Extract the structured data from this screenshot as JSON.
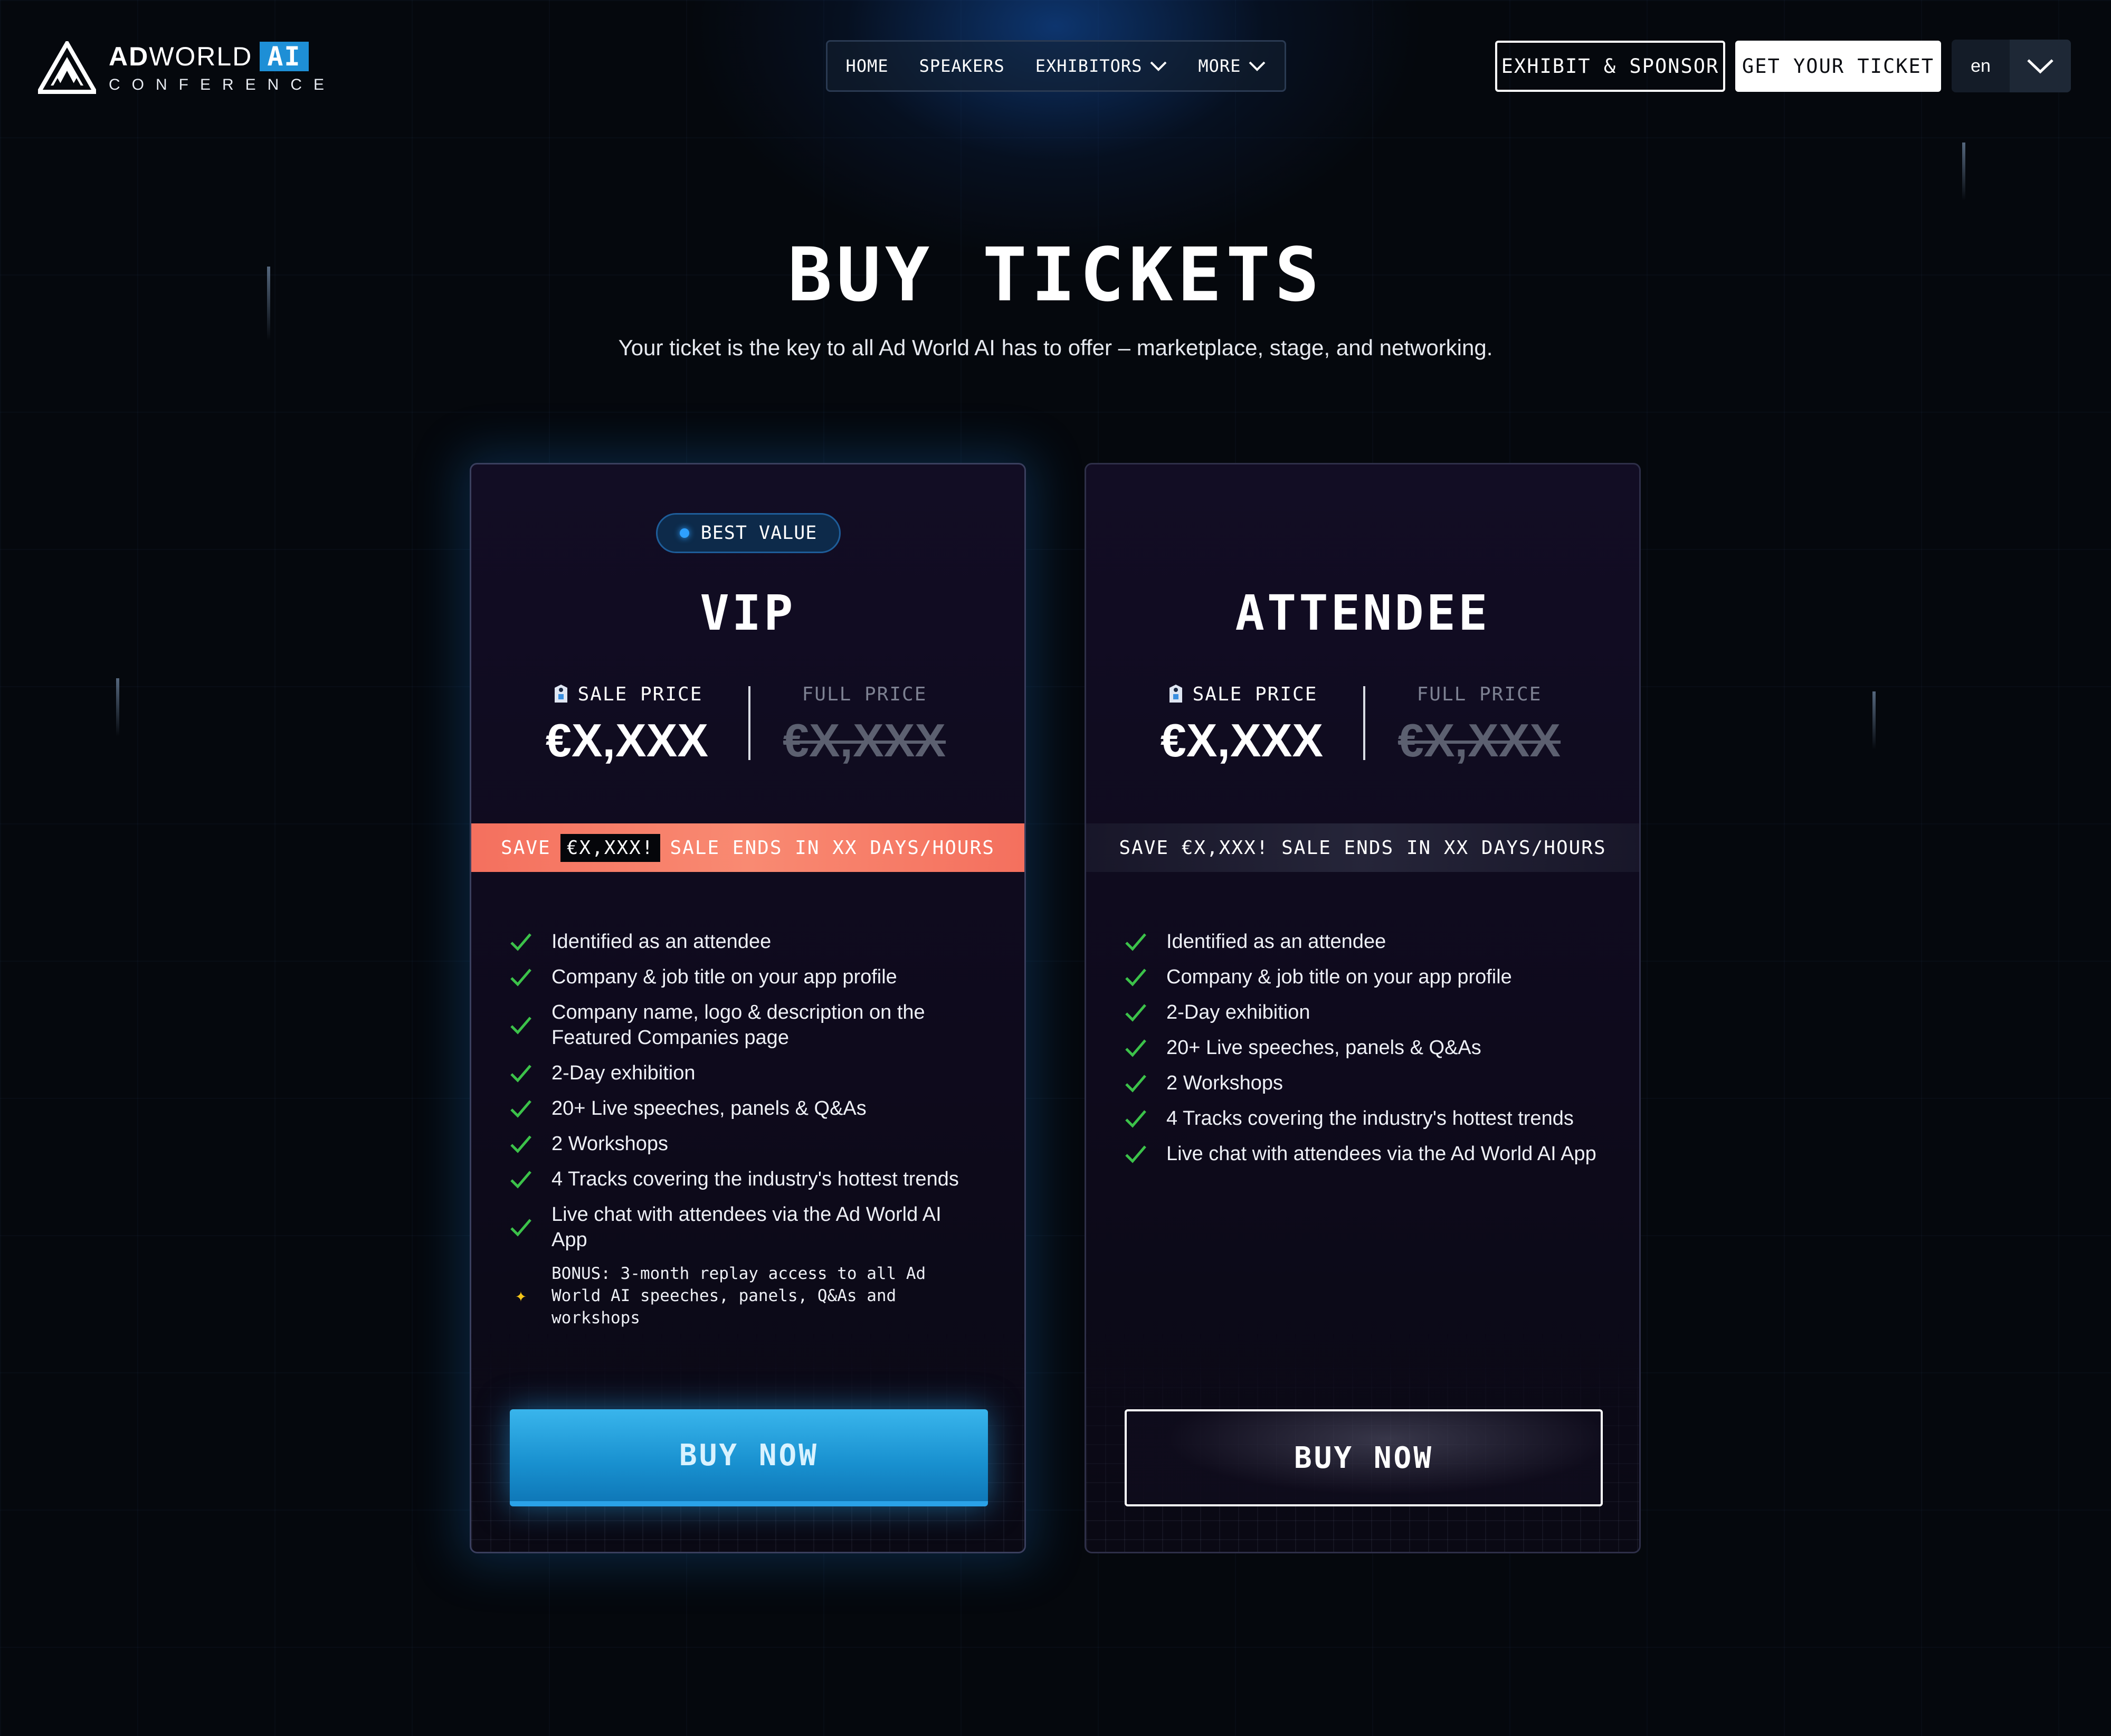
{
  "brand": {
    "name_bold": "AD",
    "name_light": "WORLD",
    "name_tag": "AI",
    "subtitle": "CONFERENCE"
  },
  "nav": {
    "items": [
      {
        "label": "HOME",
        "has_dropdown": false
      },
      {
        "label": "SPEAKERS",
        "has_dropdown": false
      },
      {
        "label": "EXHIBITORS",
        "has_dropdown": true
      },
      {
        "label": "MORE",
        "has_dropdown": true
      }
    ]
  },
  "header_actions": {
    "exhibit_label": "EXHIBIT & SPONSOR",
    "ticket_label": "GET YOUR TICKET",
    "language": "en"
  },
  "hero": {
    "title": "BUY TICKETS",
    "subtitle": "Your ticket is the key to all Ad World AI has to offer – marketplace, stage, and networking."
  },
  "cards": {
    "vip": {
      "badge": "BEST VALUE",
      "title": "VIP",
      "sale_label": "SALE PRICE",
      "sale_price": "€X,XXX",
      "full_label": "FULL PRICE",
      "full_price": "€X,XXX",
      "save_prefix": "SAVE",
      "save_amount": "€X,XXX!",
      "save_suffix": "SALE ENDS IN XX DAYS/HOURS",
      "features": [
        "Identified as an attendee",
        "Company & job title on your app profile",
        "Company name, logo & description on the Featured Companies page",
        "2-Day exhibition",
        "20+ Live speeches, panels & Q&As",
        "2 Workshops",
        "4 Tracks covering the industry's hottest trends",
        "Live chat with attendees via the Ad World AI App"
      ],
      "bonus": "BONUS: 3-month replay access to all Ad World AI speeches, panels, Q&As and workshops",
      "button": "BUY NOW"
    },
    "attendee": {
      "title": "ATTENDEE",
      "sale_label": "SALE PRICE",
      "sale_price": "€X,XXX",
      "full_label": "FULL PRICE",
      "full_price": "€X,XXX",
      "save_text": "SAVE €X,XXX! SALE ENDS IN XX DAYS/HOURS",
      "features": [
        "Identified as an attendee",
        "Company & job title on your app profile",
        "2-Day exhibition",
        "20+ Live speeches, panels & Q&As",
        "2 Workshops",
        "4 Tracks covering the industry's hottest trends",
        "Live chat with attendees via the Ad World AI App"
      ],
      "button": "BUY NOW"
    }
  },
  "colors": {
    "background": "#05080d",
    "accent_blue": "#1e8fd6",
    "sale_bar": "#f4705e",
    "check_green": "#3cc24a",
    "bonus_star": "#f5c518"
  },
  "icons": {
    "check": "check-icon",
    "bonus": "sparkle-icon",
    "price_tag": "price-tag-icon",
    "dropdown": "chevron-down-icon"
  }
}
